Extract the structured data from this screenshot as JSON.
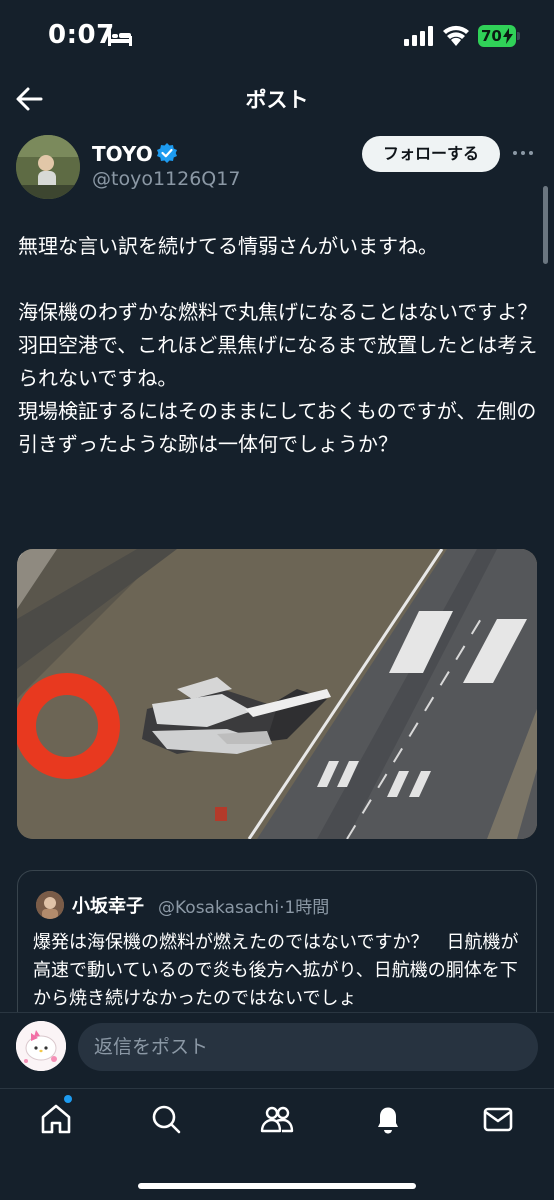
{
  "status_bar": {
    "time": "0:07",
    "battery": "70"
  },
  "header": {
    "title": "ポスト"
  },
  "author": {
    "name": "TOYO",
    "handle": "@toyo1126Q17",
    "follow_label": "フォローする"
  },
  "post": {
    "text": "無理な言い訳を続けてる情弱さんがいますね。\n\n海保機のわずかな燃料で丸焦げになることはないですよ？\n羽田空港で、これほど黒焦げになるまで放置したとは考えられないですね。\n現場検証するにはそのままにしておくものですが、左側の引きずったような跡は一体何でしょうか？"
  },
  "quote": {
    "name": "小坂幸子",
    "handle": "@Kosakasachi",
    "time": "1時間",
    "text": "爆発は海保機の燃料が燃えたのではないですか？　日航機が高速で動いているので炎も後方へ拡がり、日航機の胴体を下から焼き続けなかったのではないでしょ"
  },
  "reply": {
    "placeholder": "返信をポスト"
  },
  "tabs": [
    "home-icon",
    "search-icon",
    "communities-icon",
    "notifications-icon",
    "messages-icon"
  ],
  "colors": {
    "background": "#15202b",
    "accent": "#1d9bf0",
    "battery": "#30d158",
    "annotation_circle": "#e8391f"
  }
}
